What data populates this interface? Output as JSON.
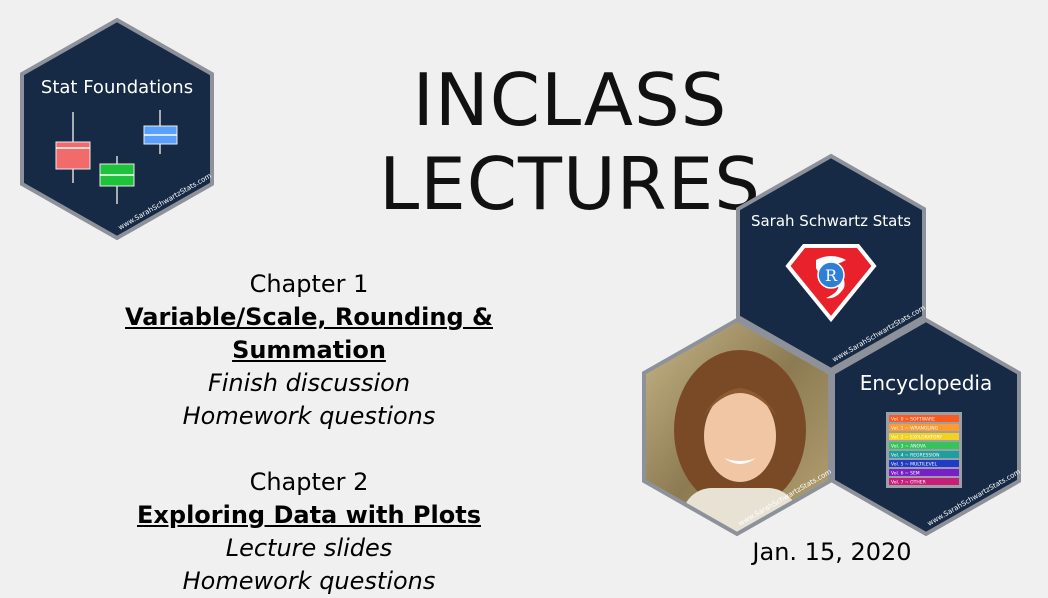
{
  "slide": {
    "title": "INCLASS LECTURES",
    "date": "Jan. 15, 2020"
  },
  "chapters": [
    {
      "label": "Chapter 1",
      "topic": "Variable/Scale, Rounding & Summation",
      "items": [
        "Finish discussion",
        "Homework questions"
      ]
    },
    {
      "label": "Chapter 2",
      "topic": "Exploring Data with Plots",
      "items": [
        "Lecture slides",
        "Homework questions"
      ]
    }
  ],
  "badges": {
    "stat_foundations": {
      "title": "Stat Foundations",
      "url": "www.SarahSchwartzStats.com"
    },
    "sss": {
      "title": "Sarah Schwartz Stats",
      "logo_letter": "R",
      "url": "www.SarahSchwartzStats.com"
    },
    "photo": {
      "url": "www.SarahSchwartzStats.com"
    },
    "encyclopedia": {
      "title": "Encyclopedia",
      "url": "www.SarahSchwartzStats.com",
      "volumes": [
        "Vol. 0 ~ SOFTWARE",
        "Vol. 1 ~ WRANGLING",
        "Vol. 2 ~ EXPLORATORY",
        "Vol. 3 ~ ANOVA",
        "Vol. 4 ~ REGRESSION",
        "Vol. 5 ~ MULTILEVEL",
        "Vol. 6 ~ SEM",
        "Vol. 7 ~ OTHER"
      ]
    }
  },
  "colors": {
    "hex_fill": "#172a45",
    "hex_border": "#8d9199",
    "box_red": "#f26b6b",
    "box_green": "#1ec33c",
    "box_blue": "#5aa0ff",
    "volume_colors": [
      "#ff5a1e",
      "#ff9a2e",
      "#f2d21e",
      "#36c35a",
      "#1e9e9e",
      "#1e3cc8",
      "#7a1ec8",
      "#c81e7a"
    ]
  }
}
